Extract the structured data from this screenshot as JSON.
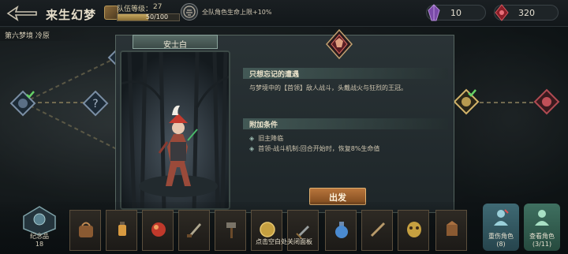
{
  "header": {
    "title": "来生幻梦",
    "team_level_label": "队伍等级：",
    "team_level_value": "27",
    "team_level_exp": "50/100",
    "team_level_progress": 0.5,
    "buff_text": "全队角色生命上限+10%",
    "resource_purple": "10",
    "resource_red": "320"
  },
  "chapter": {
    "label": "第六梦境 冷原"
  },
  "card": {
    "title": "安士白"
  },
  "info": {
    "event_title": "只想忘记的遭遇",
    "event_desc": "与梦境中的【首领】敌人战斗，头戴战火与狂烈的王冠。",
    "conditions_title": "附加条件",
    "conditions": [
      "旧主降临",
      "首领-战斗机制:回合开始时，恢复8%生命值"
    ]
  },
  "depart_button": "出发",
  "bottom": {
    "memento_label": "纪念品",
    "memento_count": "18",
    "close_hint": "点击空白处关闭面板",
    "items": [
      "satchel-icon",
      "lantern-icon",
      "orb-icon",
      "dagger-icon",
      "hammer-icon",
      "coin-icon",
      "sword-icon",
      "potion-icon",
      "blade-icon",
      "mask-icon",
      "relic-icon"
    ],
    "injured_label": "重伤角色",
    "injured_count": "(8)",
    "view_label": "查看角色",
    "view_count": "(3/11)"
  },
  "colors": {
    "accent_gold": "#c6a860",
    "depart_button": "#b8753c",
    "panel_teal": "#48605c",
    "injured_button": "#3f6a74",
    "view_button": "#3f7060"
  }
}
